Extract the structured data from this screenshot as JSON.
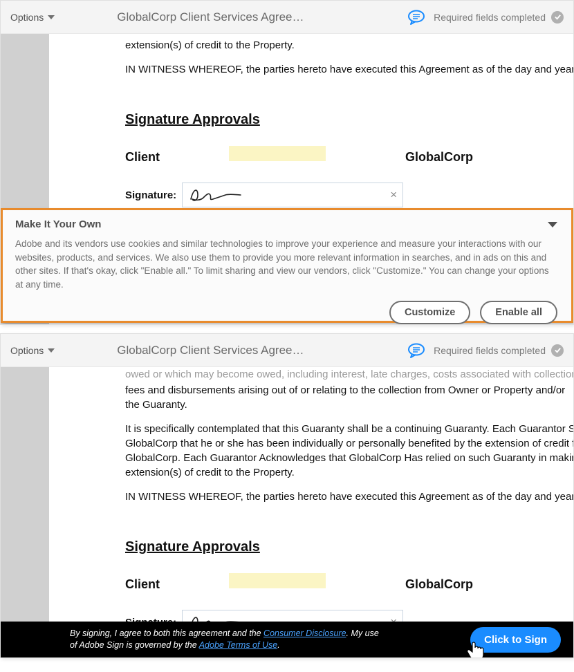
{
  "topbar": {
    "options": "Options",
    "title": "GlobalCorp Client Services Agree…",
    "required": "Required fields completed"
  },
  "doc1": {
    "p1": "extension(s) of credit to the Property.",
    "p2": "IN WITNESS WHEREOF, the parties hereto have executed this Agreement as of the day and year first above written.",
    "sig_heading": "Signature Approvals",
    "client": "Client",
    "gc": "GlobalCorp",
    "sig_label": "Signature:"
  },
  "doc2": {
    "p0": "owed or which may become owed, including interest, late charges, costs associated with collections, attorneys'",
    "p1": "fees and disbursements arising out of or relating to the collection from Owner or Property and/or the Guaranty.",
    "p2a": "It is specifically contemplated that this Guaranty shall be a continuing Guaranty. Each Guarantor Specifically represents to",
    "p2b": "GlobalCorp that he or she has been individually or personally benefited by the extension of credit from",
    "p2c": "GlobalCorp. Each Guarantor Acknowledges that GlobalCorp Has relied on such Guaranty in making the",
    "p2d": "extension(s) of credit to the Property.",
    "p3": "IN WITNESS WHEREOF, the parties hereto have executed this Agreement as of the day and year first above written.",
    "sig_heading": "Signature Approvals",
    "client": "Client",
    "gc": "GlobalCorp",
    "sig_label": "Signature:"
  },
  "cookie": {
    "title": "Make It Your Own",
    "body": "Adobe and its vendors use cookies and similar technologies to improve your experience and measure your interactions with our websites, products, and services. We also use them to provide you more relevant information in searches, and in ads on this and other sites. If that's okay, click \"Enable all.\" To limit sharing and view our vendors, click \"Customize.\" You can change your options at any time.",
    "customize": "Customize",
    "enable": "Enable all"
  },
  "agree": {
    "prefix": "By signing, I agree to both this agreement and the ",
    "link1": "Consumer Disclosure",
    "middle": ". My use of Adobe Sign is governed by the ",
    "link2": "Adobe Terms of Use",
    "suffix": ".",
    "button": "Click to Sign"
  }
}
